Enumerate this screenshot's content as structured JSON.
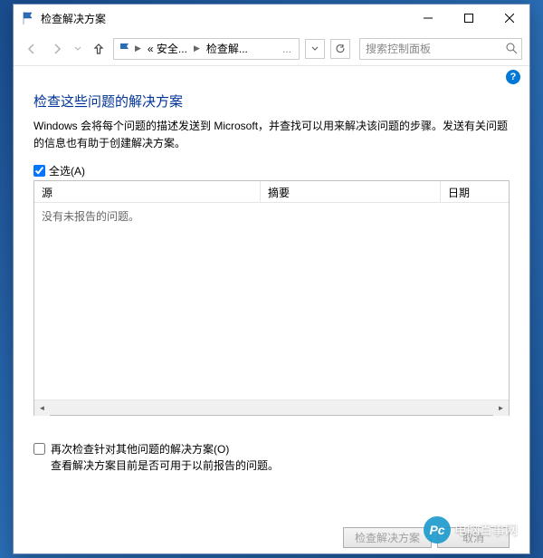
{
  "window": {
    "title": "检查解决方案"
  },
  "breadcrumb": {
    "seg1": "« 安全...",
    "seg2": "检查解...",
    "overflow": "..."
  },
  "search": {
    "placeholder": "搜索控制面板"
  },
  "page": {
    "heading": "检查这些问题的解决方案",
    "description": "Windows 会将每个问题的描述发送到 Microsoft，并查找可以用来解决该问题的步骤。发送有关问题的信息也有助于创建解决方案。",
    "select_all_label": "全选(A)"
  },
  "columns": {
    "source": "源",
    "summary": "摘要",
    "date": "日期"
  },
  "empty_message": "没有未报告的问题。",
  "recheck": {
    "label": "再次检查针对其他问题的解决方案(O)",
    "sub": "查看解决方案目前是否可用于以前报告的问题。"
  },
  "buttons": {
    "check": "检查解决方案",
    "cancel": "取消"
  },
  "watermark": {
    "icon": "Pc",
    "text": "电脑百事网"
  }
}
